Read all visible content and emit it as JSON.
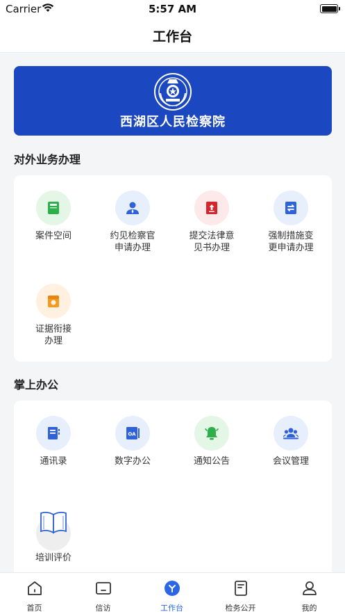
{
  "status_bar": {
    "carrier": "Carrier",
    "time": "5:57 AM"
  },
  "nav": {
    "title": "工作台"
  },
  "banner": {
    "title": "西湖区人民检察院"
  },
  "section_business": {
    "title": "对外业务办理",
    "items": [
      {
        "label": "案件空间",
        "icon": "book-icon",
        "bg": "#e4f6e6",
        "fg": "#2db04c"
      },
      {
        "label": "约见检察官\n申请办理",
        "icon": "person-icon",
        "bg": "#e7eefc",
        "fg": "#2f62d6"
      },
      {
        "label": "提交法律意\n见书办理",
        "icon": "legal-book-icon",
        "bg": "#fde9e9",
        "fg": "#d8252d"
      },
      {
        "label": "强制措施变\n更申请办理",
        "icon": "swap-icon",
        "bg": "#e7eefc",
        "fg": "#2f62d6"
      },
      {
        "label": "证据衔接\n办理",
        "icon": "wallet-icon",
        "bg": "#fff0e0",
        "fg": "#f39a21"
      }
    ]
  },
  "section_office": {
    "title": "掌上办公",
    "items": [
      {
        "label": "通讯录",
        "icon": "contacts-icon",
        "bg": "#e7eefc",
        "fg": "#2f62d6"
      },
      {
        "label": "数字办公",
        "icon": "oa-icon",
        "bg": "#e7eefc",
        "fg": "#2f62d6"
      },
      {
        "label": "通知公告",
        "icon": "bell-icon",
        "bg": "#e4f6e6",
        "fg": "#2db04c"
      },
      {
        "label": "会议管理",
        "icon": "meeting-icon",
        "bg": "#e7eefc",
        "fg": "#2f62d6"
      },
      {
        "label": "培训评价",
        "icon": "open-book-icon",
        "bg": "#eeeeee",
        "fg": "#2f62d6"
      }
    ]
  },
  "tabbar": {
    "items": [
      {
        "label": "首页",
        "icon": "home-icon"
      },
      {
        "label": "信访",
        "icon": "monitor-icon"
      },
      {
        "label": "工作台",
        "icon": "workbench-icon",
        "active": true
      },
      {
        "label": "检务公开",
        "icon": "document-icon"
      },
      {
        "label": "我的",
        "icon": "user-icon"
      }
    ],
    "active_color": "#2b66e6"
  }
}
